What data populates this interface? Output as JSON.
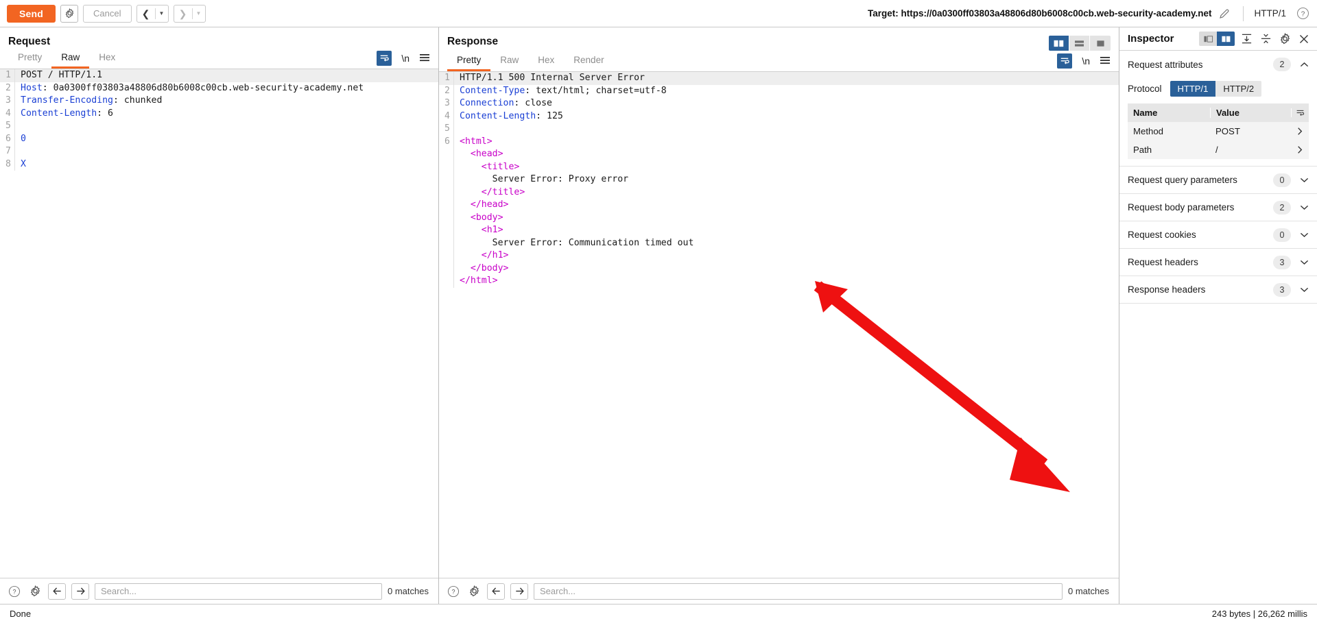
{
  "toolbar": {
    "send_label": "Send",
    "settings_icon": "gear-icon",
    "cancel_label": "Cancel",
    "back_icon": "chevron-left-icon",
    "forward_icon": "chevron-right-icon",
    "dropdown_icon": "caret-down-icon",
    "target_label": "Target: https://0a0300ff03803a48806d80b6008c00cb.web-security-academy.net",
    "edit_icon": "pencil-icon",
    "http_version": "HTTP/1",
    "help_icon": "question-circle-icon"
  },
  "request": {
    "title": "Request",
    "tabs": [
      {
        "label": "Pretty",
        "active": false
      },
      {
        "label": "Raw",
        "active": true
      },
      {
        "label": "Hex",
        "active": false
      }
    ],
    "tools": {
      "wrap_icon": "word-wrap-icon",
      "newline_label": "\\n",
      "menu_icon": "hamburger-menu-icon"
    },
    "lines": [
      {
        "n": "1",
        "highlight": true,
        "segments": [
          {
            "t": "POST / HTTP/1.1",
            "c": "k-plain"
          }
        ]
      },
      {
        "n": "2",
        "highlight": false,
        "segments": [
          {
            "t": "Host",
            "c": "k-hdr"
          },
          {
            "t": ": 0a0300ff03803a48806d80b6008c00cb.web-security-academy.net",
            "c": "k-plain"
          }
        ]
      },
      {
        "n": "3",
        "highlight": false,
        "segments": [
          {
            "t": "Transfer-Encoding",
            "c": "k-hdr"
          },
          {
            "t": ": chunked",
            "c": "k-plain"
          }
        ]
      },
      {
        "n": "4",
        "highlight": false,
        "segments": [
          {
            "t": "Content-Length",
            "c": "k-hdr"
          },
          {
            "t": ": 6",
            "c": "k-plain"
          }
        ]
      },
      {
        "n": "5",
        "highlight": false,
        "segments": [
          {
            "t": "",
            "c": "k-plain"
          }
        ]
      },
      {
        "n": "6",
        "highlight": false,
        "segments": [
          {
            "t": "0",
            "c": "k-blue"
          }
        ]
      },
      {
        "n": "7",
        "highlight": false,
        "segments": [
          {
            "t": "",
            "c": "k-plain"
          }
        ]
      },
      {
        "n": "8",
        "highlight": false,
        "segments": [
          {
            "t": "X",
            "c": "k-blue"
          }
        ]
      }
    ],
    "footer": {
      "help_icon": "question-circle-icon",
      "settings_icon": "gear-icon",
      "prev_icon": "arrow-left-icon",
      "next_icon": "arrow-right-icon",
      "search_placeholder": "Search...",
      "search_value": "",
      "matches": "0 matches"
    }
  },
  "response": {
    "title": "Response",
    "layout_buttons": [
      {
        "icon": "layout-side-by-side-icon",
        "active": true
      },
      {
        "icon": "layout-stacked-icon",
        "active": false
      },
      {
        "icon": "layout-single-icon",
        "active": false
      }
    ],
    "tabs": [
      {
        "label": "Pretty",
        "active": true
      },
      {
        "label": "Raw",
        "active": false
      },
      {
        "label": "Hex",
        "active": false
      },
      {
        "label": "Render",
        "active": false
      }
    ],
    "tools": {
      "wrap_icon": "word-wrap-icon",
      "newline_label": "\\n",
      "menu_icon": "hamburger-menu-icon"
    },
    "lines": [
      {
        "n": "1",
        "highlight": true,
        "segments": [
          {
            "t": "HTTP/1.1 500 Internal Server Error",
            "c": "k-plain"
          }
        ]
      },
      {
        "n": "2",
        "highlight": false,
        "segments": [
          {
            "t": "Content-Type",
            "c": "k-hdr"
          },
          {
            "t": ": text/html; charset=utf-8",
            "c": "k-plain"
          }
        ]
      },
      {
        "n": "3",
        "highlight": false,
        "segments": [
          {
            "t": "Connection",
            "c": "k-hdr"
          },
          {
            "t": ": close",
            "c": "k-plain"
          }
        ]
      },
      {
        "n": "4",
        "highlight": false,
        "segments": [
          {
            "t": "Content-Length",
            "c": "k-hdr"
          },
          {
            "t": ": 125",
            "c": "k-plain"
          }
        ]
      },
      {
        "n": "5",
        "highlight": false,
        "segments": [
          {
            "t": "",
            "c": "k-plain"
          }
        ]
      },
      {
        "n": "6",
        "highlight": false,
        "segments": [
          {
            "t": "<html>",
            "c": "k-tag"
          }
        ]
      },
      {
        "n": "",
        "highlight": false,
        "segments": [
          {
            "t": "  <head>",
            "c": "k-tag"
          }
        ]
      },
      {
        "n": "",
        "highlight": false,
        "segments": [
          {
            "t": "    <title>",
            "c": "k-tag"
          }
        ]
      },
      {
        "n": "",
        "highlight": false,
        "segments": [
          {
            "t": "      Server Error: Proxy error",
            "c": "k-plain"
          }
        ]
      },
      {
        "n": "",
        "highlight": false,
        "segments": [
          {
            "t": "    </title>",
            "c": "k-tag"
          }
        ]
      },
      {
        "n": "",
        "highlight": false,
        "segments": [
          {
            "t": "  </head>",
            "c": "k-tag"
          }
        ]
      },
      {
        "n": "",
        "highlight": false,
        "segments": [
          {
            "t": "  <body>",
            "c": "k-tag"
          }
        ]
      },
      {
        "n": "",
        "highlight": false,
        "segments": [
          {
            "t": "    <h1>",
            "c": "k-tag"
          }
        ]
      },
      {
        "n": "",
        "highlight": false,
        "segments": [
          {
            "t": "      Server Error: Communication timed out",
            "c": "k-plain"
          }
        ]
      },
      {
        "n": "",
        "highlight": false,
        "segments": [
          {
            "t": "    </h1>",
            "c": "k-tag"
          }
        ]
      },
      {
        "n": "",
        "highlight": false,
        "segments": [
          {
            "t": "  </body>",
            "c": "k-tag"
          }
        ]
      },
      {
        "n": "",
        "highlight": false,
        "segments": [
          {
            "t": "</html>",
            "c": "k-tag"
          }
        ]
      }
    ],
    "footer": {
      "help_icon": "question-circle-icon",
      "settings_icon": "gear-icon",
      "prev_icon": "arrow-left-icon",
      "next_icon": "arrow-right-icon",
      "search_placeholder": "Search...",
      "search_value": "",
      "matches": "0 matches"
    }
  },
  "inspector": {
    "title": "Inspector",
    "view_toggles": [
      {
        "icon": "panel-left-icon",
        "active": false
      },
      {
        "icon": "panel-right-icon",
        "active": true
      }
    ],
    "expand_all_icon": "expand-all-icon",
    "collapse_all_icon": "collapse-all-icon",
    "settings_icon": "gear-icon",
    "close_icon": "close-icon",
    "request_attributes": {
      "label": "Request attributes",
      "count": "2",
      "chevron": "chevron-up-icon",
      "protocol_label": "Protocol",
      "protocol_options": [
        {
          "label": "HTTP/1",
          "active": true
        },
        {
          "label": "HTTP/2",
          "active": false
        }
      ],
      "columns": [
        "Name",
        "Value"
      ],
      "rows": [
        {
          "name": "Method",
          "value": "POST"
        },
        {
          "name": "Path",
          "value": "/"
        }
      ]
    },
    "sections": [
      {
        "label": "Request query parameters",
        "count": "0",
        "chevron": "chevron-down-icon"
      },
      {
        "label": "Request body parameters",
        "count": "2",
        "chevron": "chevron-down-icon"
      },
      {
        "label": "Request cookies",
        "count": "0",
        "chevron": "chevron-down-icon"
      },
      {
        "label": "Request headers",
        "count": "3",
        "chevron": "chevron-down-icon"
      },
      {
        "label": "Response headers",
        "count": "3",
        "chevron": "chevron-down-icon"
      }
    ]
  },
  "statusbar": {
    "left": "Done",
    "right": "243 bytes | 26,262 millis"
  },
  "annotation": {
    "arrow_color": "#ee1111",
    "icon": "red-arrow-annotation"
  },
  "colors": {
    "accent_orange": "#f26522",
    "accent_blue": "#2a6099",
    "header_blue": "#1a3fd4",
    "tag_magenta": "#c800c8"
  }
}
